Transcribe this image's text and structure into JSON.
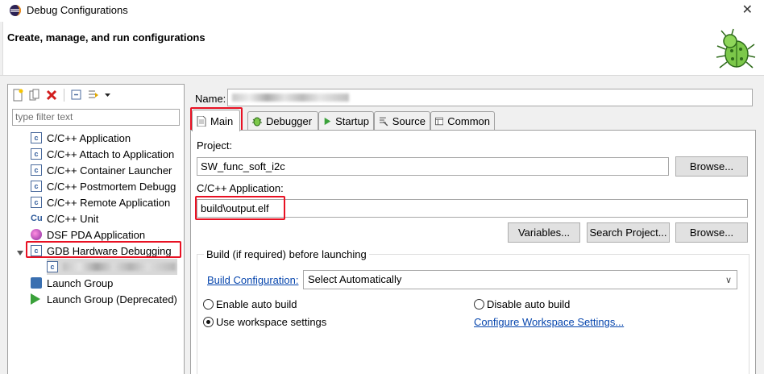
{
  "window": {
    "title": "Debug Configurations",
    "close_glyph": "✕"
  },
  "header": {
    "heading": "Create, manage, and run configurations"
  },
  "left": {
    "filter_placeholder": "type filter text",
    "items": [
      {
        "label": "C/C++ Application",
        "icon": "c-app-icon"
      },
      {
        "label": "C/C++ Attach to Application",
        "icon": "c-app-icon"
      },
      {
        "label": "C/C++ Container Launcher",
        "icon": "c-app-icon"
      },
      {
        "label": "C/C++ Postmortem Debugg",
        "icon": "c-app-icon"
      },
      {
        "label": "C/C++ Remote Application",
        "icon": "c-app-icon"
      },
      {
        "label": "C/C++ Unit",
        "icon": "cu-icon"
      },
      {
        "label": "DSF PDA Application",
        "icon": "dsf-icon"
      },
      {
        "label": "GDB Hardware Debugging",
        "icon": "c-app-icon"
      },
      {
        "label": "Launch Group",
        "icon": "launch-group-icon"
      },
      {
        "label": "Launch Group (Deprecated)",
        "icon": "play-icon"
      }
    ]
  },
  "right": {
    "name_label": "Name:",
    "tabs": [
      {
        "label": "Main"
      },
      {
        "label": "Debugger"
      },
      {
        "label": "Startup"
      },
      {
        "label": "Source"
      },
      {
        "label": "Common"
      }
    ],
    "project_label": "Project:",
    "project_value": "SW_func_soft_i2c",
    "browse_label": "Browse...",
    "app_label": "C/C++ Application:",
    "app_value": "build\\output.elf",
    "variables_label": "Variables...",
    "search_project_label": "Search Project...",
    "build_group_title": "Build (if required) before launching",
    "build_config_link": "Build Configuration:",
    "build_config_value": "Select Automatically",
    "enable_auto_build": "Enable auto build",
    "disable_auto_build": "Disable auto build",
    "use_workspace": "Use workspace settings",
    "configure_workspace_link": "Configure Workspace Settings...",
    "selected_radio": "use_workspace"
  },
  "colors": {
    "highlight_red": "#e81123",
    "link_blue": "#0645ad"
  }
}
